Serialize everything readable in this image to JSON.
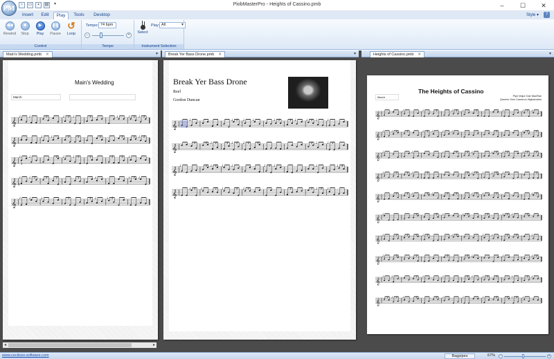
{
  "window": {
    "title": "PiobMasterPro - Heights of Cassino.pmb",
    "app_icon": "PM"
  },
  "ribbon_tabs": [
    "Insert",
    "Edit",
    "Play",
    "Tools",
    "Desktop"
  ],
  "active_tab": "Play",
  "style_menu": "Style",
  "help_label": "?",
  "control": {
    "label": "Control",
    "rewind": "Rewind",
    "stop": "Stop",
    "play": "Play",
    "pause": "Pause",
    "loop": "Loop"
  },
  "tempo": {
    "label": "Tempo",
    "field_label": "Tempo:",
    "value": "74 bpm"
  },
  "instrument": {
    "label": "Instrument Selection",
    "select": "Select",
    "play_label": "Play:",
    "play_value": "All"
  },
  "documents": [
    {
      "tab": "Main's Wedding.pmb",
      "title": "Main's Wedding",
      "fields": [
        "March"
      ],
      "staff_labels": [
        "1",
        "2"
      ]
    },
    {
      "tab": "Break Yer Bass Drone.pmb",
      "title": "Break Yer Bass Drone",
      "fields": [
        "Reel",
        "Gordon Duncan"
      ]
    },
    {
      "tab": "Heights of Cassino.pmb",
      "title": "The Heights of Cassino",
      "fields": [
        "March"
      ],
      "composer_lines": [
        "Pipe Major Dan MacRae",
        "Queens Own Cameron Highlanders"
      ]
    }
  ],
  "statusbar": {
    "link": "www.cecilsoo-software.com",
    "instrument": "Bagpipes",
    "zoom": "67%",
    "zoom_level": 0.45
  },
  "icons": {
    "rewind": "rewind-icon",
    "stop": "stop-icon",
    "play": "play-icon",
    "pause": "pause-icon",
    "loop": "loop-icon",
    "select": "bagpipe-icon"
  }
}
